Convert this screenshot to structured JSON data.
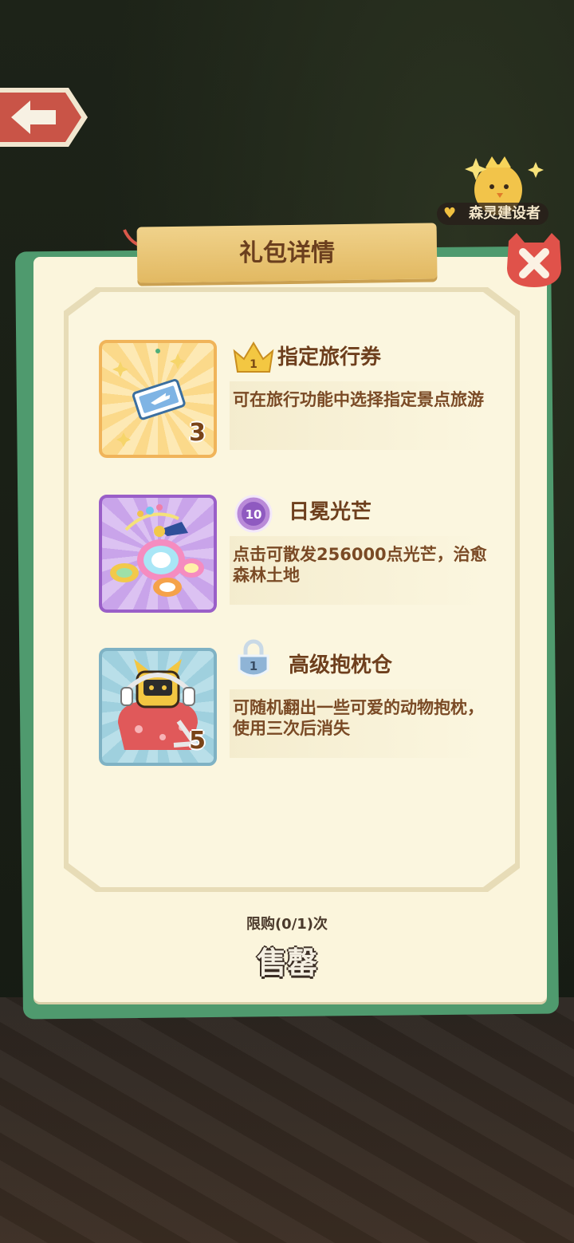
{
  "header": {
    "back_icon": "arrow-left-icon",
    "badge_label": "森灵建设者"
  },
  "dialog": {
    "title": "礼包详情",
    "close_icon": "close-icon",
    "items": [
      {
        "name": "指定旅行券",
        "description": "可在旅行功能中选择指定景点旅游",
        "quantity": "3",
        "rank_label": "1",
        "icon": "ticket-icon",
        "rank_icon": "crown-icon"
      },
      {
        "name": "日冕光芒",
        "description": "点击可散发256000点光芒，治愈森林土地",
        "quantity": "",
        "rank_label": "10",
        "icon": "corona-orbs-icon",
        "rank_icon": "purple-medal-icon"
      },
      {
        "name": "高级抱枕仓",
        "description": "可随机翻出一些可爱的动物抱枕，使用三次后消失",
        "quantity": "5",
        "rank_label": "1",
        "icon": "pillow-capsule-icon",
        "rank_icon": "blue-lock-icon"
      }
    ],
    "purchase_limit": "限购(0/1)次",
    "status": "售罄"
  },
  "colors": {
    "card_bg": "#fbf5dc",
    "frame_green": "#4f9a6e",
    "title_text": "#6b3f1e",
    "close_red": "#e0524a"
  }
}
